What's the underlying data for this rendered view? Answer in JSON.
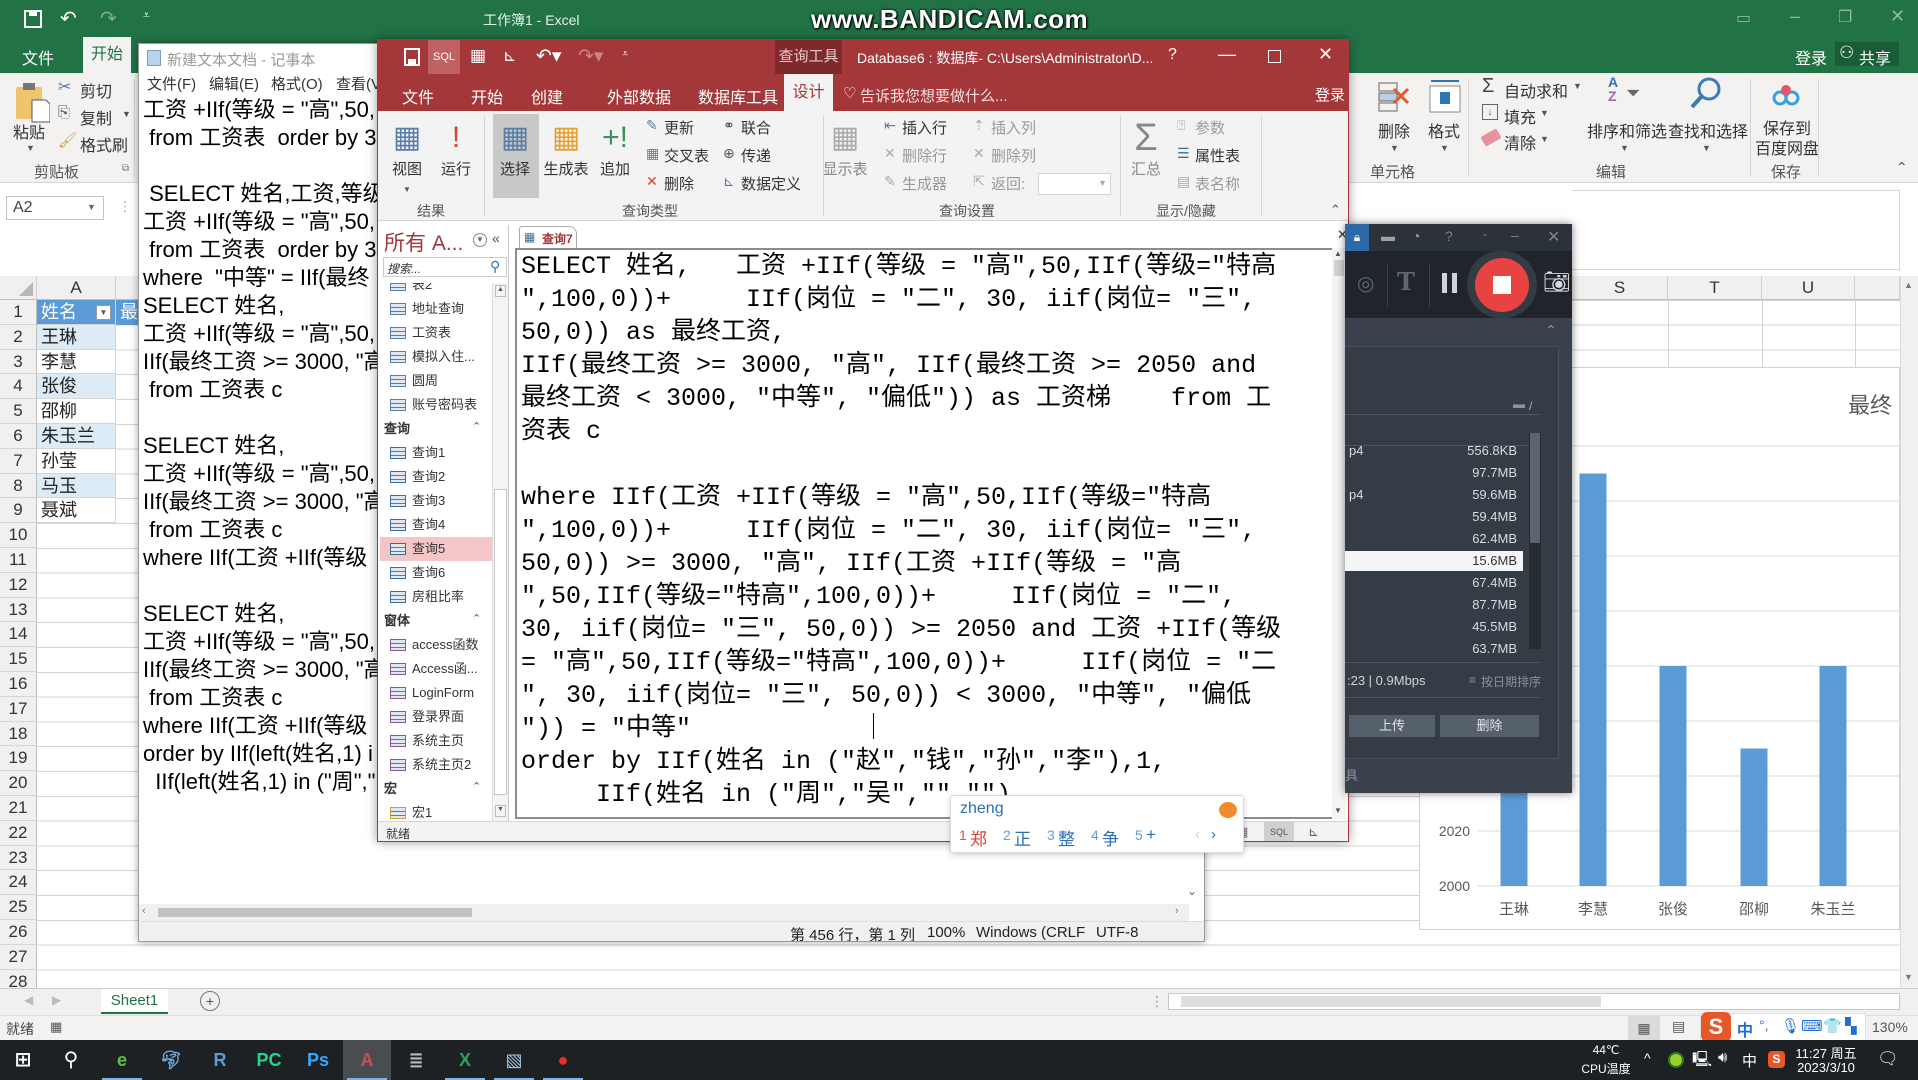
{
  "watermark": "www.BANDICAM.com",
  "excel": {
    "title": "工作簿1 - Excel",
    "tabs": [
      "文件",
      "开始"
    ],
    "login": "登录",
    "share": "共享",
    "clipboard": {
      "paste": "粘贴",
      "cut": "剪切",
      "copy": "复制",
      "format_painter": "格式刷",
      "group": "剪贴板"
    },
    "cells": {
      "delete": "删除",
      "format": "格式",
      "group": "单元格"
    },
    "editing": {
      "autosum": "自动求和",
      "fill": "填充",
      "clear": "清除",
      "sort_filter": "排序和筛选",
      "find_select": "查找和选择",
      "group": "编辑"
    },
    "save": {
      "line1": "保存到",
      "line2": "百度网盘",
      "group": "保存"
    },
    "name_box": "A2",
    "columns": {
      "a": "A",
      "s": "S",
      "t": "T",
      "u": "U"
    },
    "rows": [
      "1",
      "2",
      "3",
      "4",
      "5",
      "6",
      "7",
      "8",
      "9",
      "10",
      "11",
      "12",
      "13",
      "14",
      "15",
      "16",
      "17",
      "18",
      "19",
      "20",
      "21",
      "22",
      "23",
      "24",
      "25",
      "26",
      "27",
      "28"
    ],
    "col_a": [
      "姓名",
      "王琳",
      "李慧",
      "张俊",
      "邵柳",
      "朱玉兰",
      "孙莹",
      "马玉",
      "聂斌"
    ],
    "col_b_header": "最",
    "sheet_tab": "Sheet1",
    "status": "就绪",
    "zoom": "130%"
  },
  "chart_data": {
    "type": "bar",
    "title": "最终",
    "categories": [
      "王琳",
      "李慧",
      "张俊",
      "邵柳",
      "朱玉兰"
    ],
    "values": [
      null,
      2150,
      2080,
      2050,
      2080
    ],
    "ylim": [
      2000,
      2160
    ],
    "ytick_step": 20,
    "visible_ytick_labels": [
      "2000",
      "2020"
    ],
    "grid": true,
    "color": "#5b9bd5"
  },
  "notepad": {
    "title": "新建文本文档 - 记事本",
    "menu": [
      "文件(F)",
      "编辑(E)",
      "格式(O)",
      "查看(V"
    ],
    "lines": [
      "工资 +IIf(等级 = \"高\",50,",
      " from 工资表  order by 3",
      "",
      " SELECT 姓名,工资,等级,岗",
      "工资 +IIf(等级 = \"高\",50,",
      " from 工资表  order by 3",
      "where  \"中等\" = IIf(最终",
      "SELECT 姓名,",
      "工资 +IIf(等级 = \"高\",50,",
      "IIf(最终工资 >= 3000, \"高",
      " from 工资表 c",
      "",
      "SELECT 姓名,",
      "工资 +IIf(等级 = \"高\",50,",
      "IIf(最终工资 >= 3000, \"高",
      " from 工资表 c",
      "where IIf(工资 +IIf(等级",
      "",
      "SELECT 姓名,",
      "工资 +IIf(等级 = \"高\",50,",
      "IIf(最终工资 >= 3000, \"高",
      " from 工资表 c",
      "where IIf(工资 +IIf(等级",
      "order by IIf(left(姓名,1) i",
      "  IIf(left(姓名,1) in (\"周\",\""
    ],
    "status": {
      "position": "第 456 行，第 1 列",
      "zoom": "100%",
      "eol": "Windows (CRLF",
      "encoding": "UTF-8"
    }
  },
  "access": {
    "qat_sql": "SQL",
    "context_tab": "查询工具",
    "title": "Database6 : 数据库- C:\\Users\\Administrator\\D...",
    "help": "?",
    "tabs": [
      "文件",
      "开始",
      "创建",
      "外部数据",
      "数据库工具",
      "设计"
    ],
    "tell_me": "告诉我您想要做什么...",
    "login": "登录",
    "ribbon": {
      "view": "视图",
      "run": "运行",
      "select": "选择",
      "make_table": "生成表",
      "append": "追加",
      "update": "更新",
      "crosstab": "交叉表",
      "delete": "删除",
      "union": "联合",
      "pass_through": "传递",
      "data_definition": "数据定义",
      "show_table": "显示表",
      "insert_rows": "插入行",
      "delete_rows": "删除行",
      "builder": "生成器",
      "insert_columns": "插入列",
      "delete_columns": "删除列",
      "return": "返回:",
      "totals": "汇总",
      "parameters": "参数",
      "property_sheet": "属性表",
      "table_names": "表名称",
      "groups": {
        "results": "结果",
        "query_type": "查询类型",
        "query_setup": "查询设置",
        "show_hide": "显示/隐藏"
      }
    },
    "nav": {
      "header": "所有 A...",
      "search_placeholder": "搜索...",
      "items": [
        {
          "label": "表2",
          "kind": "table"
        },
        {
          "label": "地址查询",
          "kind": "table"
        },
        {
          "label": "工资表",
          "kind": "table"
        },
        {
          "label": "模拟入住...",
          "kind": "table"
        },
        {
          "label": "圆周",
          "kind": "table"
        },
        {
          "label": "账号密码表",
          "kind": "table"
        },
        {
          "label": "查询",
          "kind": "header"
        },
        {
          "label": "查询1",
          "kind": "query"
        },
        {
          "label": "查询2",
          "kind": "query"
        },
        {
          "label": "查询3",
          "kind": "query"
        },
        {
          "label": "查询4",
          "kind": "query"
        },
        {
          "label": "查询5",
          "kind": "query",
          "selected": true
        },
        {
          "label": "查询6",
          "kind": "query"
        },
        {
          "label": "房租比率",
          "kind": "query"
        },
        {
          "label": "窗体",
          "kind": "header"
        },
        {
          "label": "access函数",
          "kind": "form"
        },
        {
          "label": "Access函...",
          "kind": "form"
        },
        {
          "label": "LoginForm",
          "kind": "form"
        },
        {
          "label": "登录界面",
          "kind": "form"
        },
        {
          "label": "系统主页",
          "kind": "form"
        },
        {
          "label": "系统主页2",
          "kind": "form"
        },
        {
          "label": "宏",
          "kind": "header"
        },
        {
          "label": "宏1",
          "kind": "macro"
        }
      ]
    },
    "doc_tab": "查询7",
    "sql_lines": [
      "SELECT 姓名,   工资 +IIf(等级 = ″高″,50,IIf(等级=″特高",
      "″,100,0))+     IIf(岗位 = ″二″, 30, iif(岗位= ″三″,",
      "50,0)) as 最终工资,",
      "IIf(最终工资 >= 3000, ″高″, IIf(最终工资 >= 2050 and",
      "最终工资 < 3000, ″中等″, ″偏低″)) as 工资梯    from 工",
      "资表 c",
      "",
      "where IIf(工资 +IIf(等级 = ″高″,50,IIf(等级=″特高",
      "″,100,0))+     IIf(岗位 = ″二″, 30, iif(岗位= ″三″,",
      "50,0)) >= 3000, ″高″, IIf(工资 +IIf(等级 = ″高",
      "″,50,IIf(等级=″特高″,100,0))+     IIf(岗位 = ″二″,",
      "30, iif(岗位= ″三″, 50,0)) >= 2050 and 工资 +IIf(等级",
      "= ″高″,50,IIf(等级=″特高″,100,0))+     IIf(岗位 = ″二",
      "″, 30, iif(岗位= ″三″, 50,0)) < 3000, ″中等″, ″偏低",
      "″)) = ″中等″",
      "order by IIf(姓名 in (″赵″,″钱″,″孙″,″李″),1,",
      "     IIf(姓名 in (″周″,″吴″,″″,″″)"
    ],
    "status": "就绪",
    "view_sql": "SQL"
  },
  "bandicam": {
    "files": [
      {
        "name": "p4",
        "size": "556.8KB"
      },
      {
        "name": "",
        "size": "97.7MB"
      },
      {
        "name": "p4",
        "size": "59.6MB"
      },
      {
        "name": "",
        "size": "59.4MB"
      },
      {
        "name": "",
        "size": "62.4MB"
      },
      {
        "name": "",
        "size": "15.6MB",
        "selected": true
      },
      {
        "name": "",
        "size": "67.4MB"
      },
      {
        "name": "",
        "size": "87.7MB"
      },
      {
        "name": "",
        "size": "45.5MB"
      },
      {
        "name": "",
        "size": "63.7MB"
      }
    ],
    "folder_path": "/",
    "info": ":23 | 0.9Mbps",
    "sort": "按日期排序",
    "upload": "上传",
    "delete": "删除",
    "tools_partial": "具",
    "stop_color": "#e84343"
  },
  "ime": {
    "input": "zheng",
    "candidates": [
      {
        "n": "1",
        "c": "郑"
      },
      {
        "n": "2",
        "c": "正"
      },
      {
        "n": "3",
        "c": "整"
      },
      {
        "n": "4",
        "c": "争"
      },
      {
        "n": "5",
        "c": "+"
      }
    ]
  },
  "taskbar": {
    "temp": "44℃",
    "temp_label": "CPU温度",
    "ime_lang": "中",
    "time": "11:27 周五",
    "date": "2023/3/10"
  }
}
